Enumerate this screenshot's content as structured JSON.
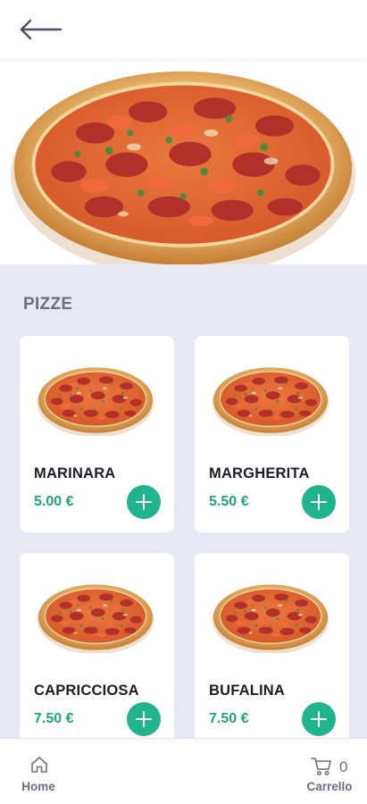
{
  "header": {
    "back_icon": "arrow-left-icon"
  },
  "hero": {
    "image": "pepperoni-pizza-photo"
  },
  "section": {
    "title": "PIZZE"
  },
  "products": [
    {
      "name": "MARINARA",
      "price": "5.00 €"
    },
    {
      "name": "MARGHERITA",
      "price": "5.50 €"
    },
    {
      "name": "CAPRICCIOSA",
      "price": "7.50 €"
    },
    {
      "name": "BUFALINA",
      "price": "7.50 €"
    }
  ],
  "nav": {
    "home_label": "Home",
    "cart_label": "Carrello",
    "cart_count": "0",
    "home_icon": "home-icon",
    "cart_icon": "cart-icon"
  },
  "colors": {
    "accent": "#1fb48c",
    "price": "#20a77e",
    "background": "#e8e9f4",
    "muted": "#6d6f7e"
  }
}
